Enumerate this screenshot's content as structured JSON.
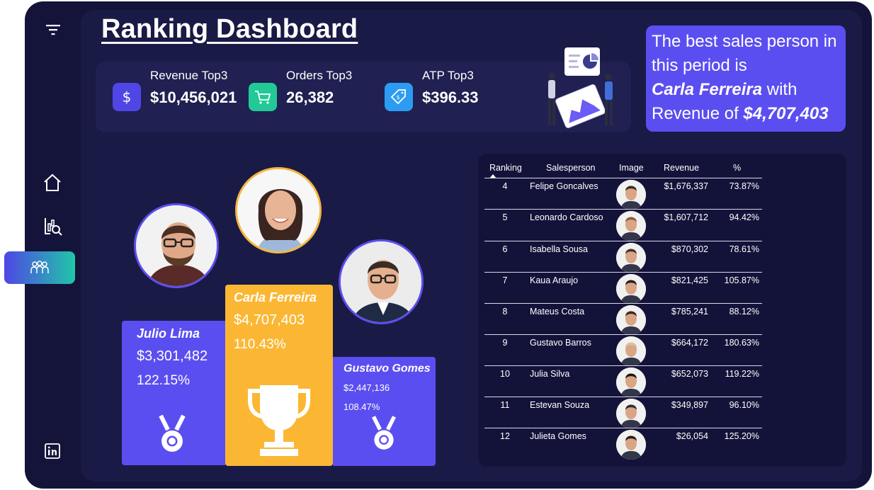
{
  "title": "Ranking Dashboard",
  "nav": {
    "items": [
      "filter-icon",
      "home-icon",
      "analytics-icon",
      "team-icon",
      "linkedin-icon"
    ],
    "active": "team-icon"
  },
  "kpis": [
    {
      "label": "Revenue Top3",
      "value": "$10,456,021",
      "icon": "dollar-icon",
      "color": "#4f46e5"
    },
    {
      "label": "Orders Top3",
      "value": "26,382",
      "icon": "cart-icon",
      "color": "#22c997"
    },
    {
      "label": "ATP Top3",
      "value": "$396.33",
      "icon": "price-tag-icon",
      "color": "#2b9cf2"
    }
  ],
  "callout": {
    "line1": "The best sales person in",
    "line2": "this period is",
    "name": "Carla Ferreira",
    "with": " with",
    "rev_prefix": "Revenue of ",
    "revenue": "$4,707,403"
  },
  "podium": {
    "first": {
      "name": "Carla Ferreira",
      "revenue": "$4,707,403",
      "pct": "110.43%",
      "color": "#fbb734"
    },
    "second": {
      "name": "Julio Lima",
      "revenue": "$3,301,482",
      "pct": "122.15%",
      "color": "#5b4ef0"
    },
    "third": {
      "name": "Gustavo Gomes",
      "revenue": "$2,447,136",
      "pct": "108.47%",
      "color": "#5b4ef0"
    }
  },
  "table": {
    "headers": [
      "Ranking",
      "Salesperson",
      "Image",
      "Revenue",
      "%"
    ],
    "rows": [
      {
        "rank": "4",
        "name": "Felipe Goncalves",
        "revenue": "$1,676,337",
        "pct": "73.87%"
      },
      {
        "rank": "5",
        "name": "Leonardo Cardoso",
        "revenue": "$1,607,712",
        "pct": "94.42%"
      },
      {
        "rank": "6",
        "name": "Isabella Sousa",
        "revenue": "$870,302",
        "pct": "78.61%"
      },
      {
        "rank": "7",
        "name": "Kaua Araujo",
        "revenue": "$821,425",
        "pct": "105.87%"
      },
      {
        "rank": "8",
        "name": "Mateus Costa",
        "revenue": "$785,241",
        "pct": "88.12%"
      },
      {
        "rank": "9",
        "name": "Gustavo Barros",
        "revenue": "$664,172",
        "pct": "180.63%"
      },
      {
        "rank": "10",
        "name": "Julia Silva",
        "revenue": "$652,073",
        "pct": "119.22%"
      },
      {
        "rank": "11",
        "name": "Estevan Souza",
        "revenue": "$349,897",
        "pct": "96.10%"
      },
      {
        "rank": "12",
        "name": "Julieta Gomes",
        "revenue": "$26,054",
        "pct": "125.20%"
      }
    ]
  }
}
